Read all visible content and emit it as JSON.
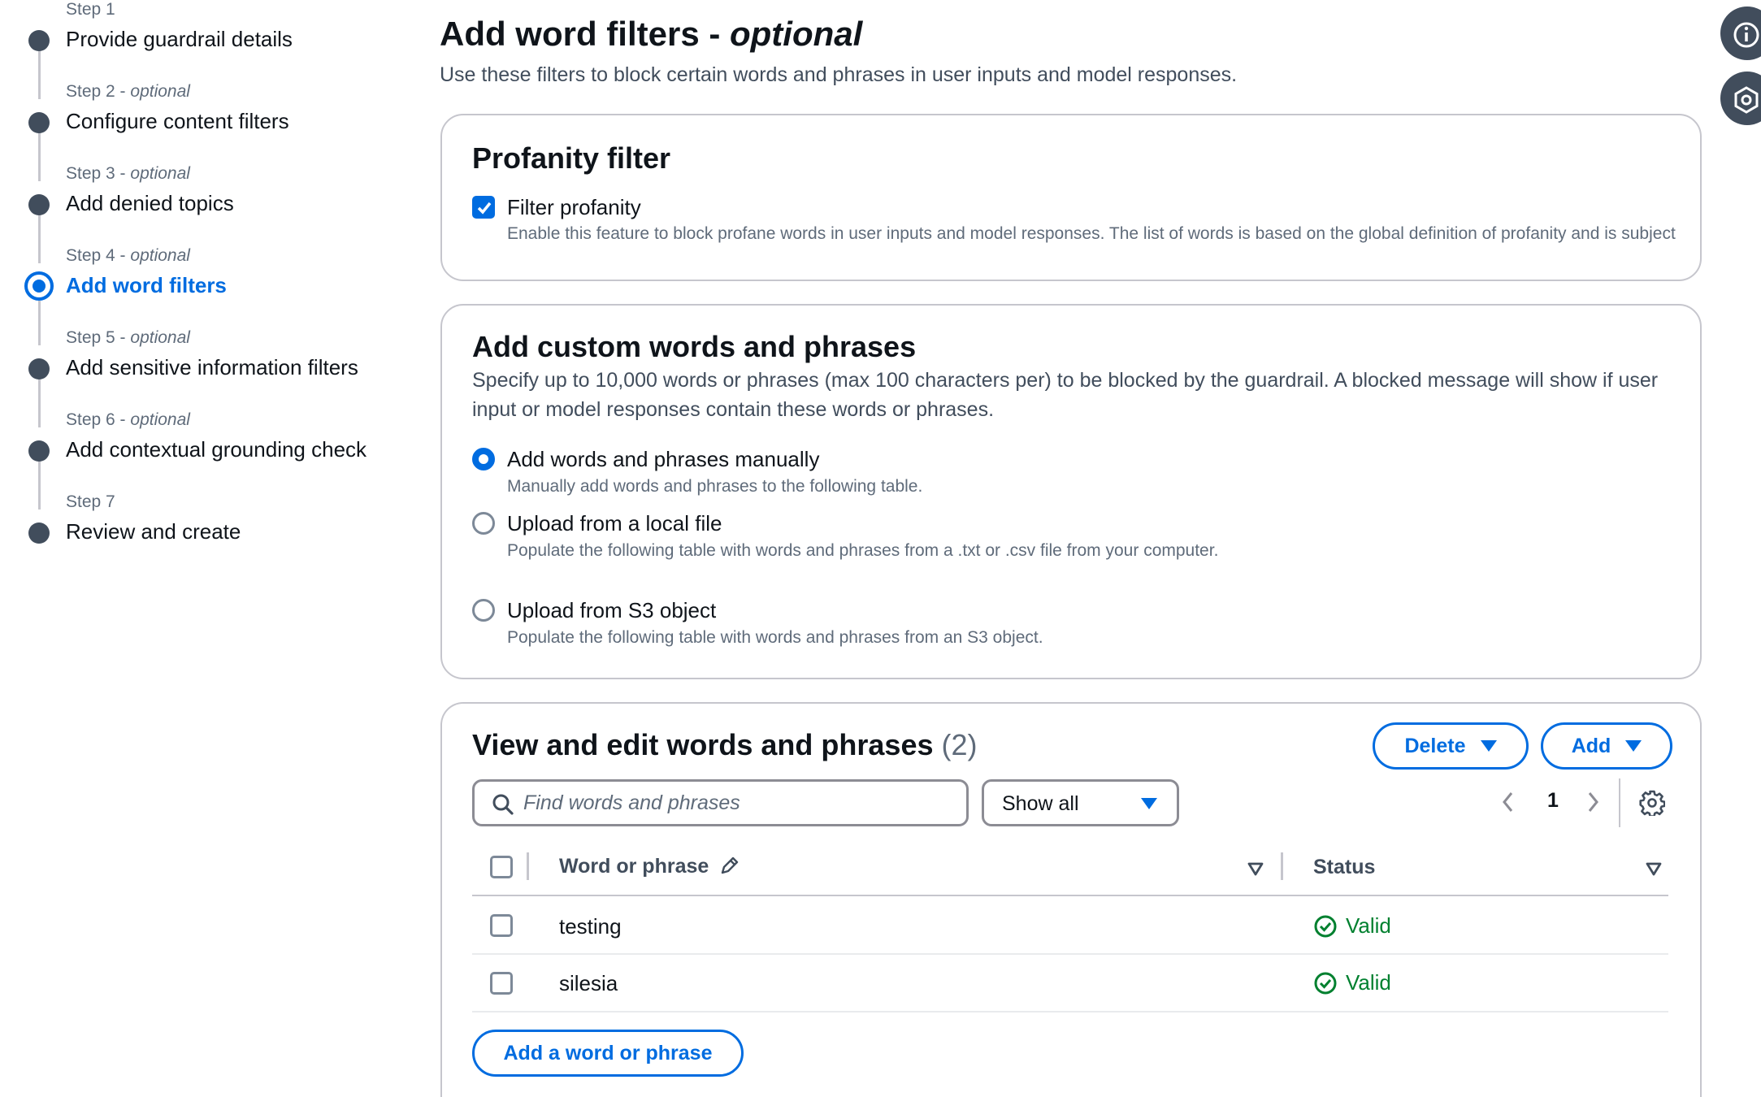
{
  "steps": [
    {
      "number": "Step 1",
      "optional": "",
      "title": "Provide guardrail details"
    },
    {
      "number": "Step 2",
      "optional": "optional",
      "title": "Configure content filters"
    },
    {
      "number": "Step 3",
      "optional": "optional",
      "title": "Add denied topics"
    },
    {
      "number": "Step 4",
      "optional": "optional",
      "title": "Add word filters"
    },
    {
      "number": "Step 5",
      "optional": "optional",
      "title": "Add sensitive information filters"
    },
    {
      "number": "Step 6",
      "optional": "optional",
      "title": "Add contextual grounding check"
    },
    {
      "number": "Step 7",
      "optional": "",
      "title": "Review and create"
    }
  ],
  "active_step": "Step 4",
  "optional_separator": " - ",
  "header": {
    "title": "Add word filters - ",
    "title_suffix": "optional",
    "description": "Use these filters to block certain words and phrases in user inputs and model responses."
  },
  "side_icons": [
    "info-icon",
    "feedback-icon"
  ],
  "profanity": {
    "title": "Profanity filter",
    "checkbox_label": "Filter profanity",
    "checked": true,
    "description": "Enable this feature to block profane words in user inputs and model responses. The list of words is based on the global definition of profanity and is subject"
  },
  "custom": {
    "title": "Add custom words and phrases",
    "description": "Specify up to 10,000 words or phrases (max 100 characters per) to be blocked by the guardrail. A blocked message will show if user input or model responses contain these words or phrases.",
    "options": [
      {
        "label": "Add words and phrases manually",
        "description": "Manually add words and phrases to the following table.",
        "selected": true
      },
      {
        "label": "Upload from a local file",
        "description": "Populate the following table with words and phrases from a .txt or .csv file from your computer.",
        "selected": false
      },
      {
        "label": "Upload from S3 object",
        "description": "Populate the following table with words and phrases from an S3 object.",
        "selected": false
      }
    ]
  },
  "table": {
    "title": "View and edit words and phrases",
    "count": "(2)",
    "delete_label": "Delete",
    "add_label": "Add",
    "search_placeholder": "Find words and phrases",
    "filter_value": "Show all",
    "page": "1",
    "columns": [
      "Word or phrase",
      "Status"
    ],
    "rows": [
      {
        "word": "testing",
        "status": "Valid"
      },
      {
        "word": "silesia",
        "status": "Valid"
      }
    ],
    "add_row_label": "Add a word or phrase"
  },
  "colors": {
    "accent": "#006ce0",
    "success": "#00802f",
    "text": "#0f141a",
    "muted": "#5f6b7a",
    "border": "#c6c6cd"
  }
}
